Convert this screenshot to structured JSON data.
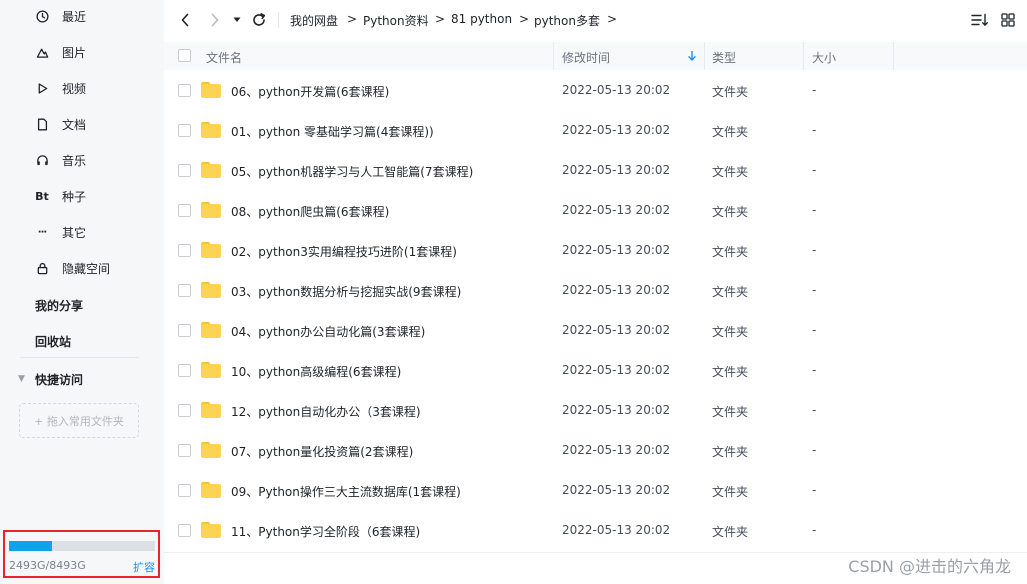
{
  "sidebar": {
    "items": [
      {
        "label": "最近",
        "icon": "clock-icon"
      },
      {
        "label": "图片",
        "icon": "image-icon"
      },
      {
        "label": "视频",
        "icon": "play-icon"
      },
      {
        "label": "文档",
        "icon": "document-icon"
      },
      {
        "label": "音乐",
        "icon": "headphones-icon"
      },
      {
        "label": "种子",
        "icon": "bt-icon",
        "glyph": "Bt"
      },
      {
        "label": "其它",
        "icon": "more-icon",
        "glyph": "···"
      },
      {
        "label": "隐藏空间",
        "icon": "lock-icon"
      }
    ],
    "my_share": "我的分享",
    "recycle_bin": "回收站",
    "quick_access": "快捷访问",
    "drop_hint": "+ 拖入常用文件夹",
    "storage": {
      "used_text": "2493G/8493G",
      "used_fraction": 0.2935,
      "expand_label": "扩容",
      "bar_color": "#11a2ee"
    }
  },
  "toolbar": {
    "breadcrumb": [
      "我的网盘",
      "Python资料",
      "81 python",
      "python多套"
    ],
    "separator": ">"
  },
  "table": {
    "headers": {
      "name": "文件名",
      "modified": "修改时间",
      "type": "类型",
      "size": "大小"
    },
    "sort_icon": "arrow-down-icon",
    "rows": [
      {
        "name": "06、python开发篇(6套课程)",
        "modified": "2022-05-13 20:02",
        "type": "文件夹",
        "size": "-"
      },
      {
        "name": "01、python 零基础学习篇(4套课程))",
        "modified": "2022-05-13 20:02",
        "type": "文件夹",
        "size": "-"
      },
      {
        "name": "05、python机器学习与人工智能篇(7套课程)",
        "modified": "2022-05-13 20:02",
        "type": "文件夹",
        "size": "-"
      },
      {
        "name": "08、python爬虫篇(6套课程)",
        "modified": "2022-05-13 20:02",
        "type": "文件夹",
        "size": "-"
      },
      {
        "name": "02、python3实用编程技巧进阶(1套课程)",
        "modified": "2022-05-13 20:02",
        "type": "文件夹",
        "size": "-"
      },
      {
        "name": "03、python数据分析与挖掘实战(9套课程)",
        "modified": "2022-05-13 20:02",
        "type": "文件夹",
        "size": "-"
      },
      {
        "name": "04、python办公自动化篇(3套课程)",
        "modified": "2022-05-13 20:02",
        "type": "文件夹",
        "size": "-"
      },
      {
        "name": "10、python高级编程(6套课程)",
        "modified": "2022-05-13 20:02",
        "type": "文件夹",
        "size": "-"
      },
      {
        "name": "12、python自动化办公（3套课程)",
        "modified": "2022-05-13 20:02",
        "type": "文件夹",
        "size": "-"
      },
      {
        "name": "07、python量化投资篇(2套课程)",
        "modified": "2022-05-13 20:02",
        "type": "文件夹",
        "size": "-"
      },
      {
        "name": "09、Python操作三大主流数据库(1套课程)",
        "modified": "2022-05-13 20:02",
        "type": "文件夹",
        "size": "-"
      },
      {
        "name": "11、Python学习全阶段（6套课程)",
        "modified": "2022-05-13 20:02",
        "type": "文件夹",
        "size": "-"
      }
    ]
  },
  "watermark": "CSDN @进击的六角龙",
  "colors": {
    "accent": "#11a2ee",
    "link": "#1a8ff0",
    "highlight_border": "#e8232d",
    "folder": "#fdd452"
  }
}
